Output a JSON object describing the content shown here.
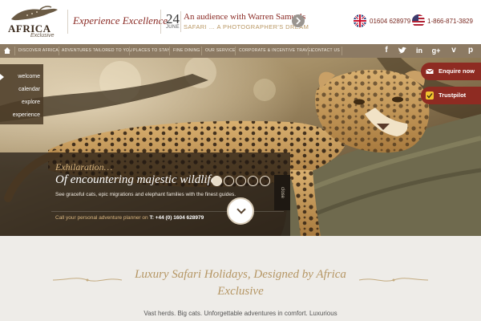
{
  "header": {
    "logo_text": "AFRICA",
    "logo_sub": "Exclusive",
    "tagline": "Experience Excellence",
    "event": {
      "day": "24",
      "month": "JUNE",
      "title": "An audience with Warren Samuels",
      "subtitle": "SAFARI … A PHOTOGRAPHER'S DREAM"
    },
    "phones": [
      {
        "flag": "uk-flag-icon",
        "number": "01604 628979"
      },
      {
        "flag": "us-flag-icon",
        "number": "1-866-871-3829"
      }
    ]
  },
  "nav": {
    "items": [
      "DISCOVER AFRICA",
      "ADVENTURES TAILORED TO YOU",
      "PLACES TO STAY",
      "FINE DINING",
      "OUR SERVICE",
      "CORPORATE & INCENTIVE TRAVEL",
      "CONTACT US"
    ],
    "social": [
      "facebook-icon",
      "twitter-icon",
      "linkedin-icon",
      "google-plus-icon",
      "vimeo-icon",
      "pinterest-icon"
    ]
  },
  "side_menu": [
    "welcome",
    "calendar",
    "explore",
    "experience"
  ],
  "side_buttons": {
    "enquire": "Enquire now",
    "trustpilot": "Trustpilot"
  },
  "hero": {
    "line1": "Exhilaration…",
    "line2": "Of encountering majestic wildlife",
    "line3": "See graceful cats, epic migrations and elephant families with the finest guides.",
    "planner_label": "Call your personal adventure planner on",
    "planner_phone": "T: +44 (0) 1604 628979",
    "close_label": "close",
    "slides": 5,
    "active_slide": 1
  },
  "intro": {
    "title": "Luxury Safari Holidays, Designed by Africa Exclusive",
    "text": "Vast herds. Big cats. Unforgettable adventures in comfort. Luxurious"
  },
  "colors": {
    "brand_red": "#8e2b22",
    "gold": "#b59664",
    "nav_bg": "#8c7a63"
  }
}
